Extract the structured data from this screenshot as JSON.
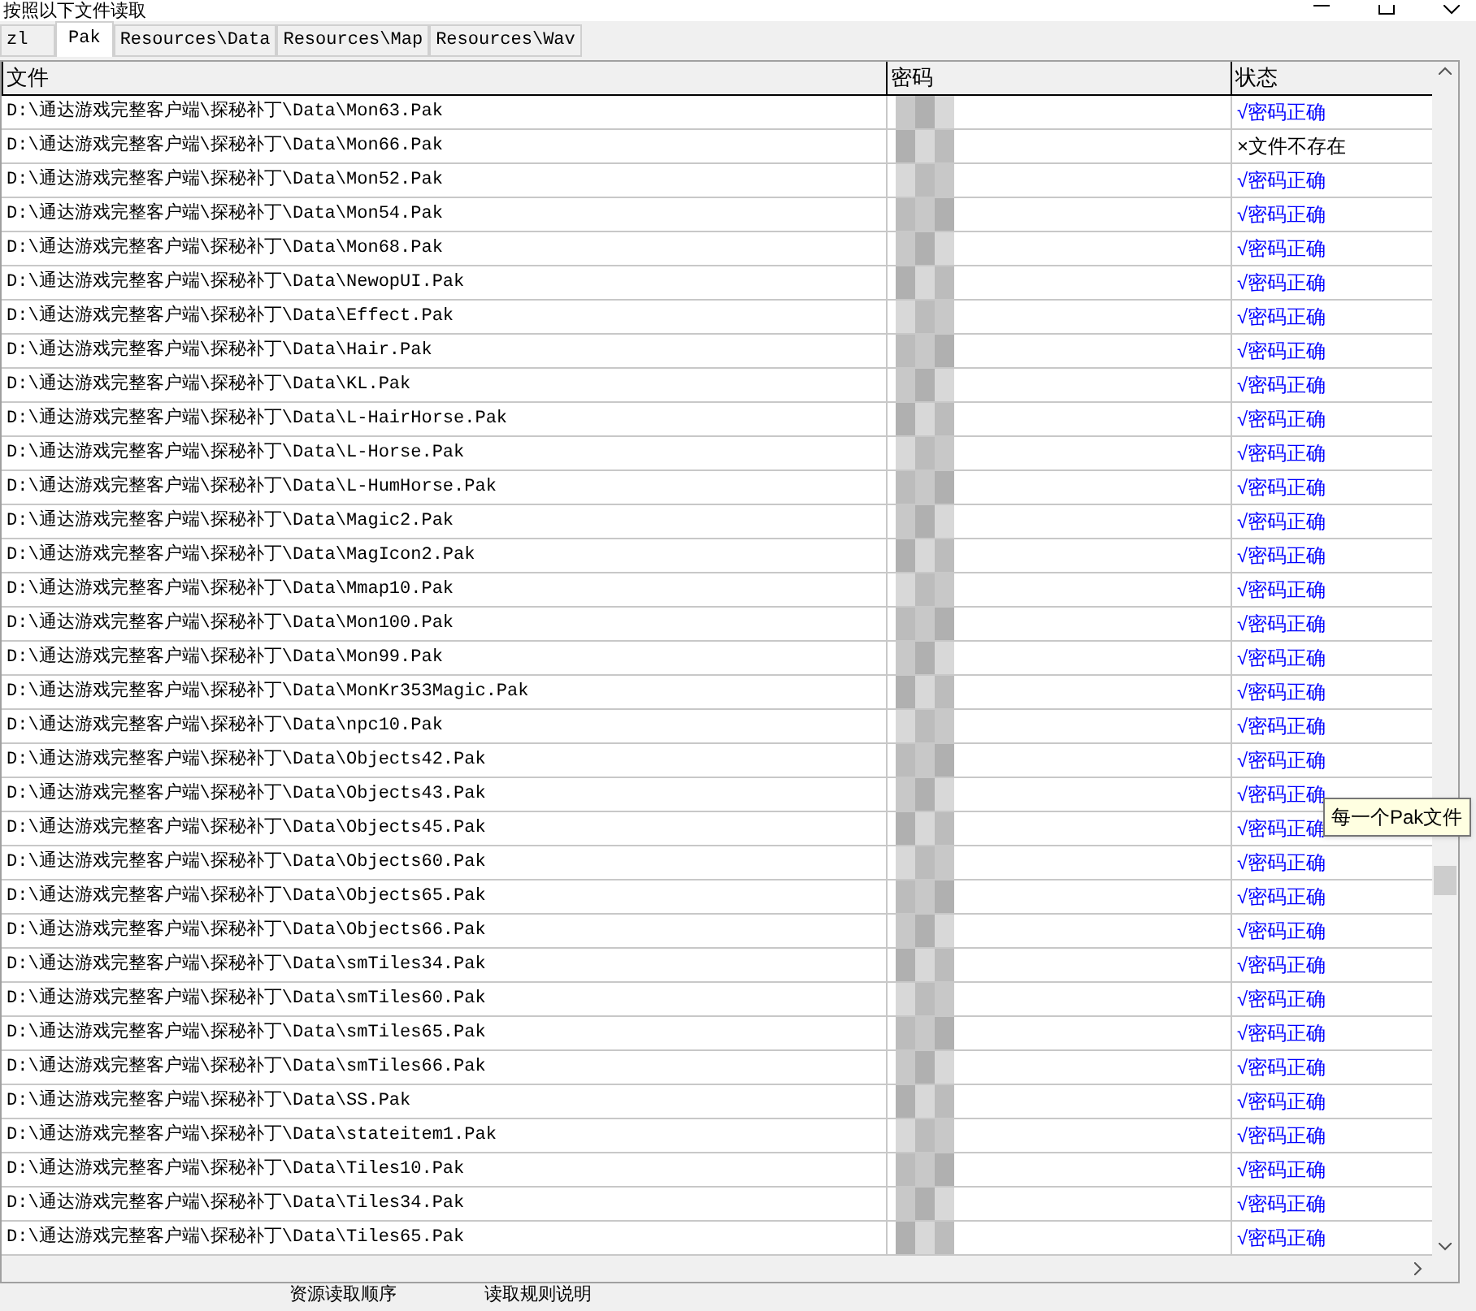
{
  "window": {
    "title": "按照以下文件读取"
  },
  "tabs": [
    {
      "label": "zl",
      "selected": false
    },
    {
      "label": "Pak",
      "selected": true
    },
    {
      "label": "Resources\\Data",
      "selected": false
    },
    {
      "label": "Resources\\Map",
      "selected": false
    },
    {
      "label": "Resources\\Wav",
      "selected": false
    }
  ],
  "table": {
    "columns": [
      "文件",
      "密码",
      "状态"
    ],
    "rows": [
      {
        "file": "D:\\通达游戏完整客户端\\探秘补丁\\Data\\Mon63.Pak",
        "status": "√密码正确",
        "kind": "ok"
      },
      {
        "file": "D:\\通达游戏完整客户端\\探秘补丁\\Data\\Mon66.Pak",
        "status": "×文件不存在",
        "kind": "missing"
      },
      {
        "file": "D:\\通达游戏完整客户端\\探秘补丁\\Data\\Mon52.Pak",
        "status": "√密码正确",
        "kind": "ok"
      },
      {
        "file": "D:\\通达游戏完整客户端\\探秘补丁\\Data\\Mon54.Pak",
        "status": "√密码正确",
        "kind": "ok"
      },
      {
        "file": "D:\\通达游戏完整客户端\\探秘补丁\\Data\\Mon68.Pak",
        "status": "√密码正确",
        "kind": "ok"
      },
      {
        "file": "D:\\通达游戏完整客户端\\探秘补丁\\Data\\NewopUI.Pak",
        "status": "√密码正确",
        "kind": "ok"
      },
      {
        "file": "D:\\通达游戏完整客户端\\探秘补丁\\Data\\Effect.Pak",
        "status": "√密码正确",
        "kind": "ok"
      },
      {
        "file": "D:\\通达游戏完整客户端\\探秘补丁\\Data\\Hair.Pak",
        "status": "√密码正确",
        "kind": "ok"
      },
      {
        "file": "D:\\通达游戏完整客户端\\探秘补丁\\Data\\KL.Pak",
        "status": "√密码正确",
        "kind": "ok"
      },
      {
        "file": "D:\\通达游戏完整客户端\\探秘补丁\\Data\\L-HairHorse.Pak",
        "status": "√密码正确",
        "kind": "ok"
      },
      {
        "file": "D:\\通达游戏完整客户端\\探秘补丁\\Data\\L-Horse.Pak",
        "status": "√密码正确",
        "kind": "ok"
      },
      {
        "file": "D:\\通达游戏完整客户端\\探秘补丁\\Data\\L-HumHorse.Pak",
        "status": "√密码正确",
        "kind": "ok"
      },
      {
        "file": "D:\\通达游戏完整客户端\\探秘补丁\\Data\\Magic2.Pak",
        "status": "√密码正确",
        "kind": "ok"
      },
      {
        "file": "D:\\通达游戏完整客户端\\探秘补丁\\Data\\MagIcon2.Pak",
        "status": "√密码正确",
        "kind": "ok"
      },
      {
        "file": "D:\\通达游戏完整客户端\\探秘补丁\\Data\\Mmap10.Pak",
        "status": "√密码正确",
        "kind": "ok"
      },
      {
        "file": "D:\\通达游戏完整客户端\\探秘补丁\\Data\\Mon100.Pak",
        "status": "√密码正确",
        "kind": "ok"
      },
      {
        "file": "D:\\通达游戏完整客户端\\探秘补丁\\Data\\Mon99.Pak",
        "status": "√密码正确",
        "kind": "ok"
      },
      {
        "file": "D:\\通达游戏完整客户端\\探秘补丁\\Data\\MonKr353Magic.Pak",
        "status": "√密码正确",
        "kind": "ok"
      },
      {
        "file": "D:\\通达游戏完整客户端\\探秘补丁\\Data\\npc10.Pak",
        "status": "√密码正确",
        "kind": "ok"
      },
      {
        "file": "D:\\通达游戏完整客户端\\探秘补丁\\Data\\Objects42.Pak",
        "status": "√密码正确",
        "kind": "ok"
      },
      {
        "file": "D:\\通达游戏完整客户端\\探秘补丁\\Data\\Objects43.Pak",
        "status": "√密码正确",
        "kind": "ok"
      },
      {
        "file": "D:\\通达游戏完整客户端\\探秘补丁\\Data\\Objects45.Pak",
        "status": "√密码正确",
        "kind": "ok"
      },
      {
        "file": "D:\\通达游戏完整客户端\\探秘补丁\\Data\\Objects60.Pak",
        "status": "√密码正确",
        "kind": "ok"
      },
      {
        "file": "D:\\通达游戏完整客户端\\探秘补丁\\Data\\Objects65.Pak",
        "status": "√密码正确",
        "kind": "ok"
      },
      {
        "file": "D:\\通达游戏完整客户端\\探秘补丁\\Data\\Objects66.Pak",
        "status": "√密码正确",
        "kind": "ok"
      },
      {
        "file": "D:\\通达游戏完整客户端\\探秘补丁\\Data\\smTiles34.Pak",
        "status": "√密码正确",
        "kind": "ok"
      },
      {
        "file": "D:\\通达游戏完整客户端\\探秘补丁\\Data\\smTiles60.Pak",
        "status": "√密码正确",
        "kind": "ok"
      },
      {
        "file": "D:\\通达游戏完整客户端\\探秘补丁\\Data\\smTiles65.Pak",
        "status": "√密码正确",
        "kind": "ok"
      },
      {
        "file": "D:\\通达游戏完整客户端\\探秘补丁\\Data\\smTiles66.Pak",
        "status": "√密码正确",
        "kind": "ok"
      },
      {
        "file": "D:\\通达游戏完整客户端\\探秘补丁\\Data\\SS.Pak",
        "status": "√密码正确",
        "kind": "ok"
      },
      {
        "file": "D:\\通达游戏完整客户端\\探秘补丁\\Data\\stateitem1.Pak",
        "status": "√密码正确",
        "kind": "ok"
      },
      {
        "file": "D:\\通达游戏完整客户端\\探秘补丁\\Data\\Tiles10.Pak",
        "status": "√密码正确",
        "kind": "ok"
      },
      {
        "file": "D:\\通达游戏完整客户端\\探秘补丁\\Data\\Tiles34.Pak",
        "status": "√密码正确",
        "kind": "ok"
      },
      {
        "file": "D:\\通达游戏完整客户端\\探秘补丁\\Data\\Tiles65.Pak",
        "status": "√密码正确",
        "kind": "ok"
      }
    ]
  },
  "tooltip": "每一个Pak文件",
  "bottom_labels": [
    "资源读取顺序",
    "读取规则说明"
  ]
}
